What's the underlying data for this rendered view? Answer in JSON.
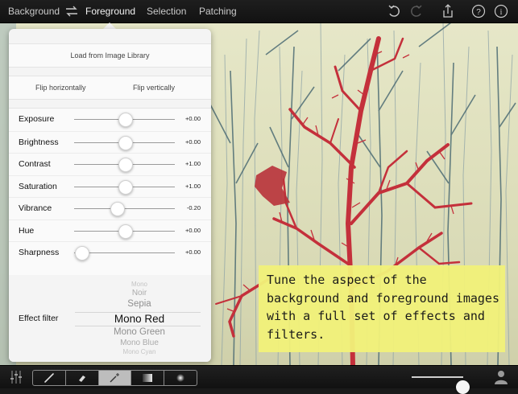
{
  "topbar": {
    "background_label": "Background",
    "swap_icon": "swap-icon",
    "foreground_label": "Foreground",
    "selection_label": "Selection",
    "patching_label": "Patching",
    "icons": [
      "undo-icon",
      "redo-icon",
      "share-icon",
      "help-icon",
      "info-icon"
    ]
  },
  "panel": {
    "load_label": "Load from Image Library",
    "flip_h_label": "Flip horizontally",
    "flip_v_label": "Flip vertically",
    "sliders": [
      {
        "label": "Exposure",
        "value_text": "+0.00",
        "level": 0.5
      },
      {
        "label": "Brightness",
        "value_text": "+0.00",
        "level": 0.5
      },
      {
        "label": "Contrast",
        "value_text": "+1.00",
        "level": 0.5
      },
      {
        "label": "Saturation",
        "value_text": "+1.00",
        "level": 0.5
      },
      {
        "label": "Vibrance",
        "value_text": "-0.20",
        "level": 0.42
      },
      {
        "label": "Hue",
        "value_text": "+0.00",
        "level": 0.5
      },
      {
        "label": "Sharpness",
        "value_text": "+0.00",
        "level": 0.07
      }
    ],
    "effect_label": "Effect filter",
    "effect_options": [
      "Mono",
      "Noir",
      "Sepia",
      "Mono Red",
      "Mono Green",
      "Mono Blue",
      "Mono Cyan"
    ],
    "effect_selected": "Mono Red"
  },
  "callout": {
    "text": "Tune the aspect of the background and foreground images with a full set of effects and filters."
  },
  "bottombar": {
    "adjust_icon": "sliders-icon",
    "tools": [
      "brush-icon",
      "eraser-icon",
      "magic-wand-icon",
      "gradient-icon",
      "soft-brush-icon"
    ],
    "active_tool": "magic-wand-icon",
    "brush_size_level": 0.98,
    "user_icon": "user-icon"
  },
  "colors": {
    "sky": "#e6e7c8",
    "red_branches": "#c8303a",
    "callout": "#f2f27a",
    "bar": "#161616"
  }
}
